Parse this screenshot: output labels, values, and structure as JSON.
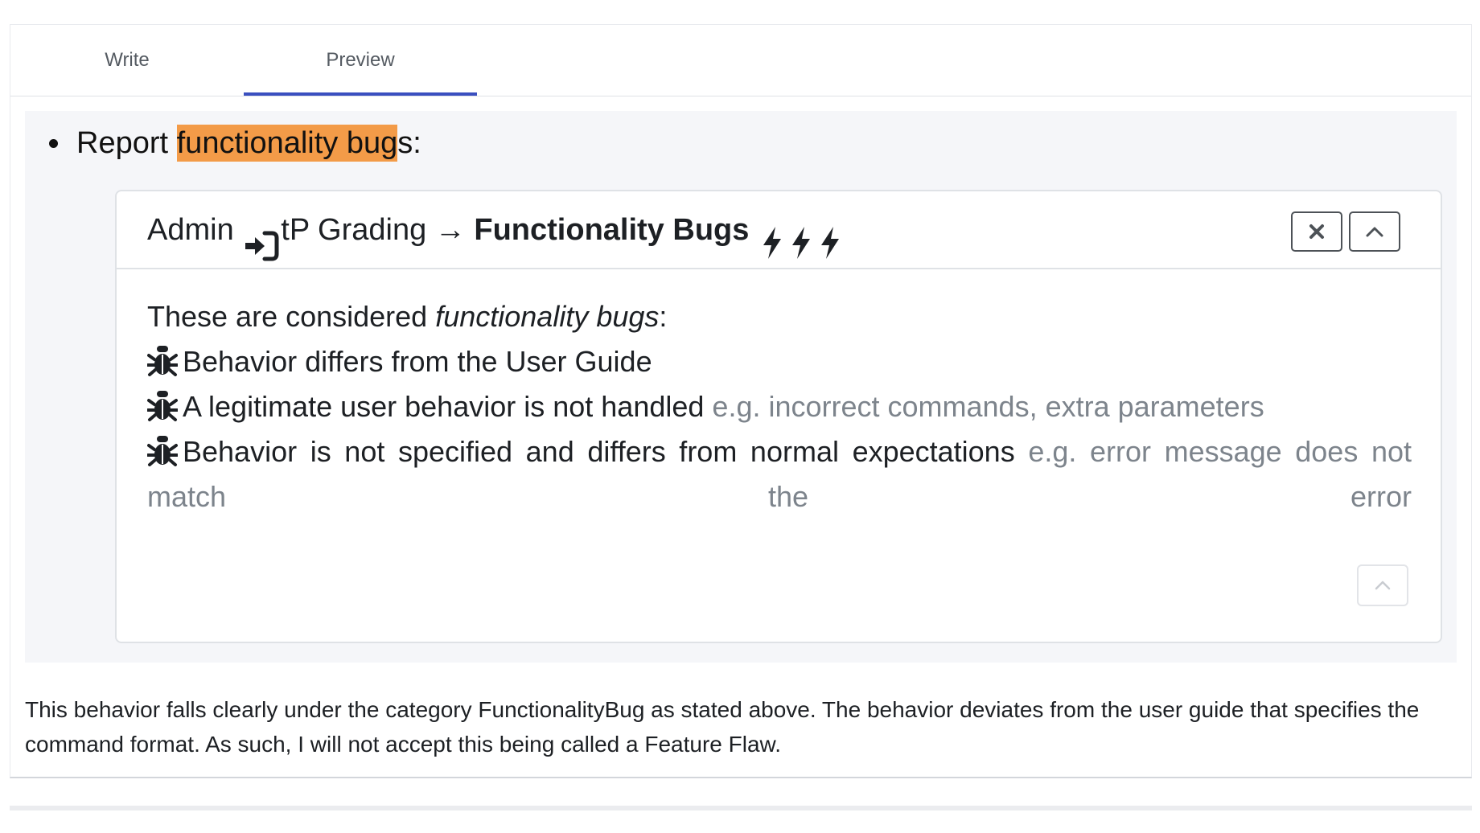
{
  "tabs": [
    {
      "label": "Write",
      "active": false
    },
    {
      "label": "Preview",
      "active": true
    }
  ],
  "preview": {
    "bullet": {
      "prefix": "Report ",
      "highlight": "functionality bug",
      "suffix": "s:",
      "highlight_color": "#f39b48"
    },
    "panel": {
      "header": {
        "part1": "Admin",
        "part2": "tP Grading → ",
        "strong": "Functionality Bugs",
        "icons": [
          "login-icon",
          "bolt-icon",
          "bolt-icon",
          "bolt-icon"
        ]
      },
      "buttons": {
        "close_icon": "close-icon",
        "collapse_icon": "chevron-up-icon",
        "scroll_top_icon": "chevron-up-icon"
      },
      "body": {
        "intro_prefix": "These are considered ",
        "intro_em": "functionality bugs",
        "intro_suffix": ":",
        "items": [
          {
            "icon": "bug-icon",
            "text": "Behavior differs from the User Guide",
            "example": ""
          },
          {
            "icon": "bug-icon",
            "text": "A legitimate user behavior is not handled",
            "example": "e.g. incorrect commands, extra parameters"
          },
          {
            "icon": "bug-icon",
            "text": "Behavior is not specified and differs from normal expectations",
            "example": "e.g. error message does not match the error"
          }
        ]
      }
    }
  },
  "comment": "This behavior falls clearly under the category FunctionalityBug as stated above. The behavior deviates from the user guide that specifies the command format. As such, I will not accept this being called a Feature Flaw.",
  "colors": {
    "tab_active_underline": "#3a4fbf",
    "preview_background": "#f5f6f9",
    "muted_text": "#7d848c"
  }
}
